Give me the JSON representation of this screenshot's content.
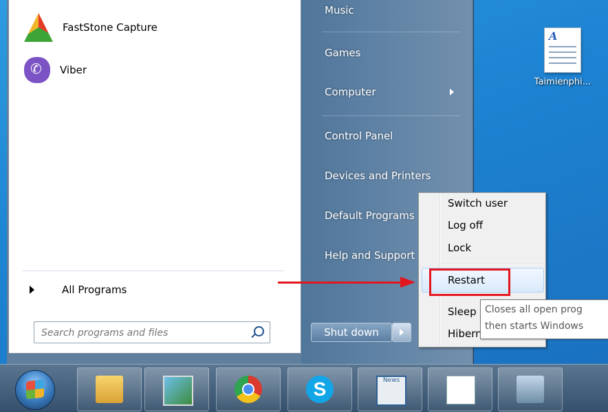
{
  "desktop": {
    "icon_label": "Taimienphi..."
  },
  "start_menu": {
    "pinned": [
      {
        "label": "FastStone Capture",
        "icon": "faststone-capture-icon"
      },
      {
        "label": "Viber",
        "icon": "viber-icon"
      }
    ],
    "all_programs": "All Programs",
    "search_placeholder": "Search programs and files",
    "right_items": {
      "music": "Music",
      "games": "Games",
      "computer": "Computer",
      "control_panel": "Control Panel",
      "devices": "Devices and Printers",
      "default_programs": "Default Programs",
      "help": "Help and Support"
    },
    "shutdown_label": "Shut down"
  },
  "power_menu": {
    "switch_user": "Switch user",
    "log_off": "Log off",
    "lock": "Lock",
    "restart": "Restart",
    "sleep": "Sleep",
    "hibernate": "Hibernate"
  },
  "tooltip": {
    "line1": "Closes all open prog",
    "line2": "then starts Windows"
  },
  "taskbar": {
    "apps": [
      "windows-explorer-icon",
      "photo-viewer-icon",
      "chrome-icon",
      "skype-icon",
      "news-icon",
      "document-icon",
      "network-icon"
    ],
    "news_text": "News"
  },
  "colors": {
    "annotation": "#e3161e",
    "highlight": "#d9eafc"
  }
}
